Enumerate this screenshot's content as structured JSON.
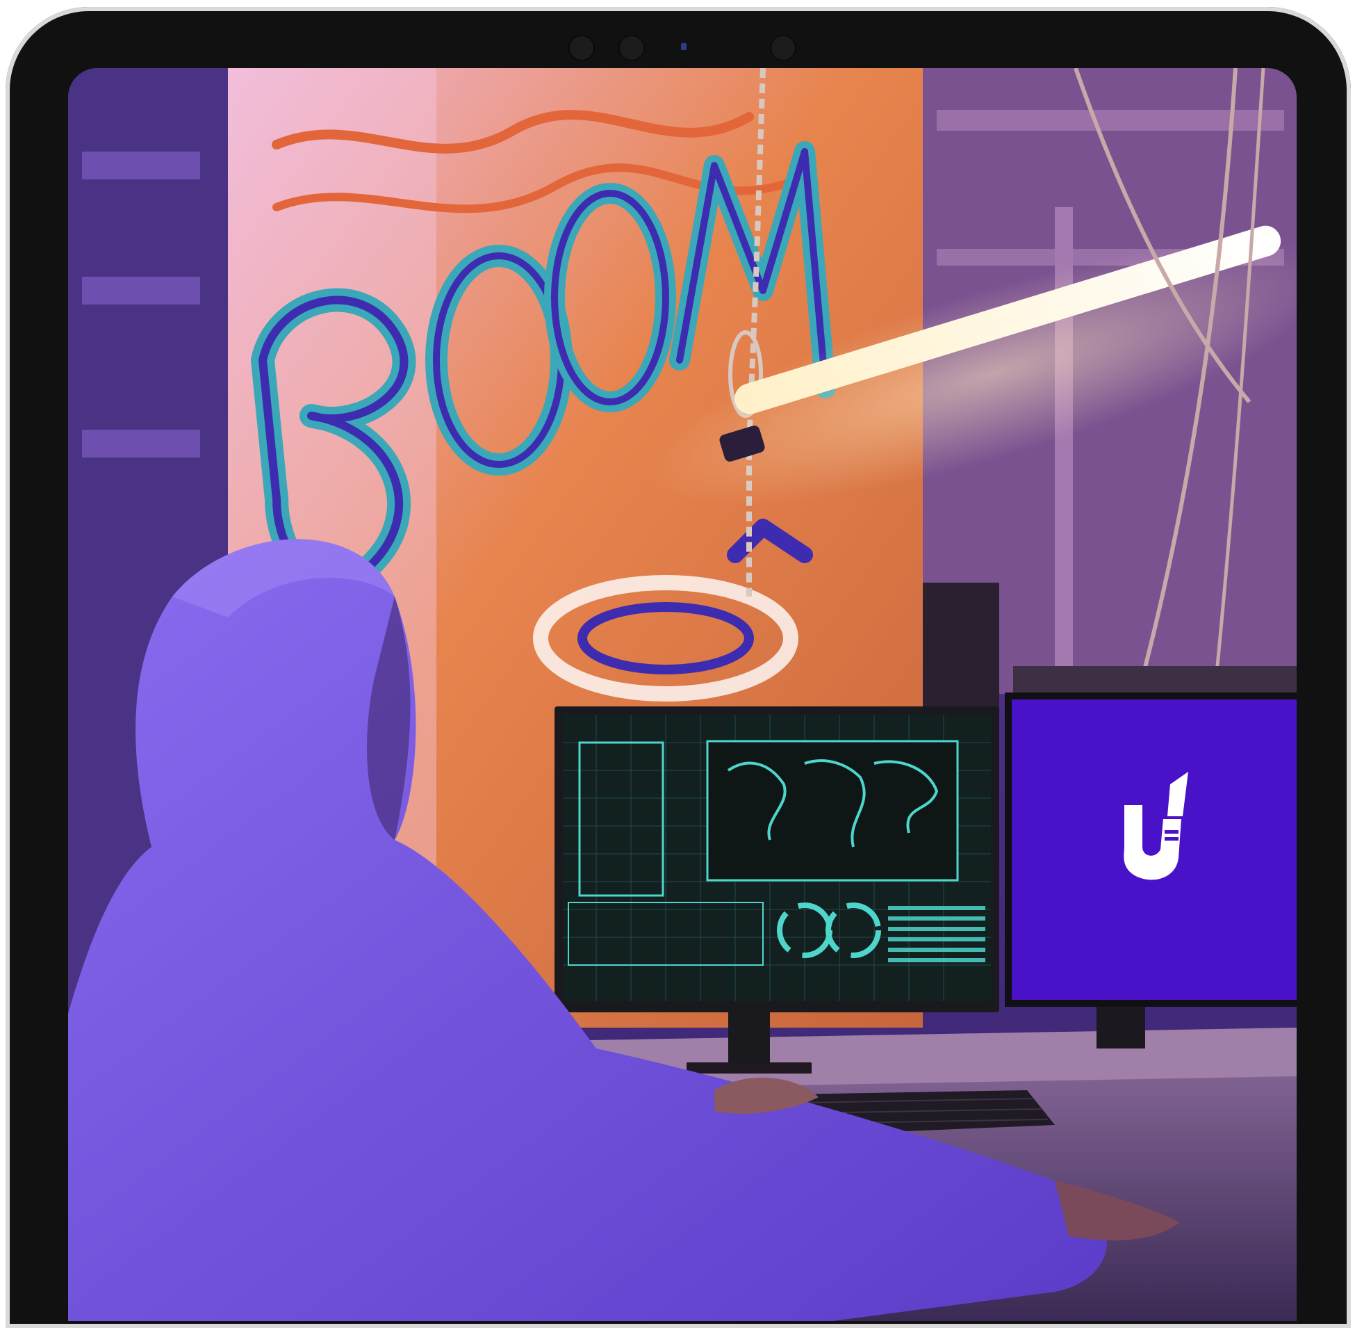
{
  "device": {
    "type": "tablet",
    "frame_color": "#111111"
  },
  "photo": {
    "scene": "hooded-person-at-computer-desk",
    "graffiti_text": "BOOM",
    "palette": {
      "purple": "#6a3fd0",
      "orange": "#e0733f",
      "neon": "#fff2d8",
      "brand": "#4a12c8"
    }
  },
  "brand_logo": {
    "icon": "u-logo-icon",
    "color": "#ffffff"
  }
}
